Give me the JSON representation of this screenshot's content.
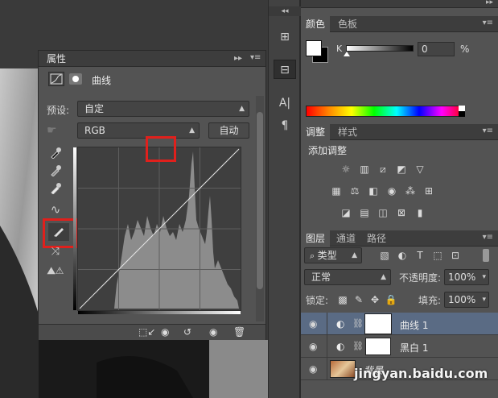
{
  "colors": {
    "highlight": "#e0201c",
    "panel": "#535353",
    "selected_layer": "#5a6b84"
  },
  "properties": {
    "tab": "属性",
    "title": "曲线",
    "preset_label": "预设:",
    "preset_value": "自定",
    "channel_value": "RGB",
    "auto_label": "自动"
  },
  "tools": [
    "eyedropper-black-icon",
    "eyedropper-gray-icon",
    "eyedropper-white-icon",
    "curve-draw-icon",
    "pencil-icon",
    "smooth-icon",
    "warning-icon"
  ],
  "color_panel": {
    "tabs": [
      "颜色",
      "色板"
    ],
    "channel_label": "K",
    "k_value": "0",
    "unit": "%"
  },
  "adjustments": {
    "tabs": [
      "调整",
      "样式"
    ],
    "title": "添加调整"
  },
  "layers": {
    "tabs": [
      "图层",
      "通道",
      "路径"
    ],
    "filter_label": "类型",
    "blend_mode": "正常",
    "opacity_label": "不透明度:",
    "opacity_value": "100%",
    "lock_label": "锁定:",
    "fill_label": "填充:",
    "fill_value": "100%",
    "items": [
      {
        "name": "曲线 1"
      },
      {
        "name": "黑白 1"
      },
      {
        "name": "背景"
      }
    ]
  },
  "watermark": "jingyan.baidu.com"
}
